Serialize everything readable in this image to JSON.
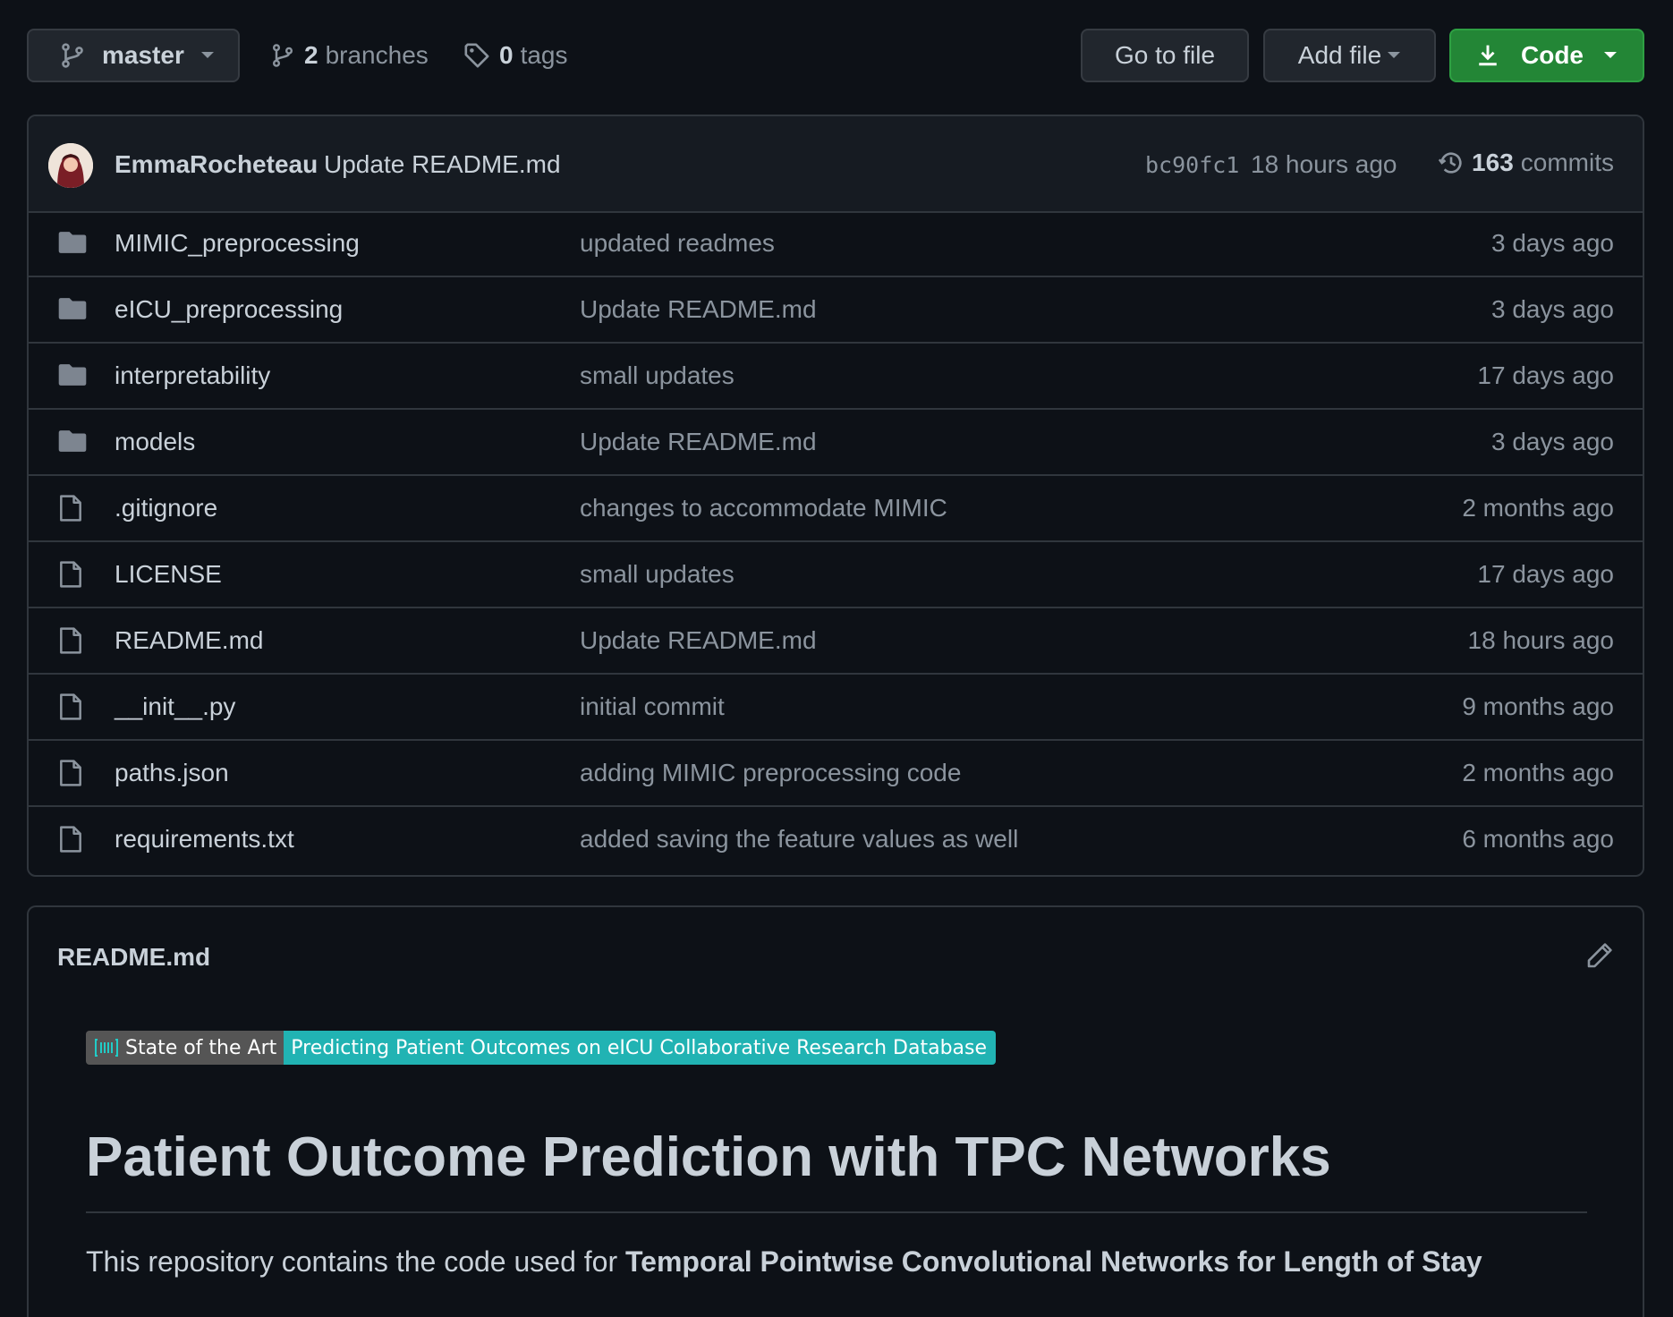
{
  "branch_selector": {
    "label": "master"
  },
  "branches": {
    "count": "2",
    "label": "branches"
  },
  "tags": {
    "count": "0",
    "label": "tags"
  },
  "actions": {
    "go_to_file": "Go to file",
    "add_file": "Add file",
    "code": "Code"
  },
  "latest_commit": {
    "author": "EmmaRocheteau",
    "message": "Update README.md",
    "sha": "bc90fc1",
    "time": "18 hours ago",
    "commit_count": "163",
    "commit_label": "commits"
  },
  "files": [
    {
      "name": "MIMIC_preprocessing",
      "type": "folder",
      "message": "updated readmes",
      "age": "3 days ago"
    },
    {
      "name": "eICU_preprocessing",
      "type": "folder",
      "message": "Update README.md",
      "age": "3 days ago"
    },
    {
      "name": "interpretability",
      "type": "folder",
      "message": "small updates",
      "age": "17 days ago"
    },
    {
      "name": "models",
      "type": "folder",
      "message": "Update README.md",
      "age": "3 days ago"
    },
    {
      "name": ".gitignore",
      "type": "file",
      "message": "changes to accommodate MIMIC",
      "age": "2 months ago"
    },
    {
      "name": "LICENSE",
      "type": "file",
      "message": "small updates",
      "age": "17 days ago"
    },
    {
      "name": "README.md",
      "type": "file",
      "message": "Update README.md",
      "age": "18 hours ago"
    },
    {
      "name": "__init__.py",
      "type": "file",
      "message": "initial commit",
      "age": "9 months ago"
    },
    {
      "name": "paths.json",
      "type": "file",
      "message": "adding MIMIC preprocessing code",
      "age": "2 months ago"
    },
    {
      "name": "requirements.txt",
      "type": "file",
      "message": "added saving the feature values as well",
      "age": "6 months ago"
    }
  ],
  "readme": {
    "filename": "README.md",
    "badge_left": "State of the Art",
    "badge_right": "Predicting Patient Outcomes on eICU Collaborative Research Database",
    "title": "Patient Outcome Prediction with TPC Networks",
    "intro_text": "This repository contains the code used for ",
    "intro_bold": "Temporal Pointwise Convolutional Networks for Length of Stay"
  },
  "colors": {
    "background": "#0d1117",
    "code_button": "#238636",
    "badge_left": "#555555",
    "badge_right": "#21b3b3",
    "folder_icon": "#7d8590"
  }
}
